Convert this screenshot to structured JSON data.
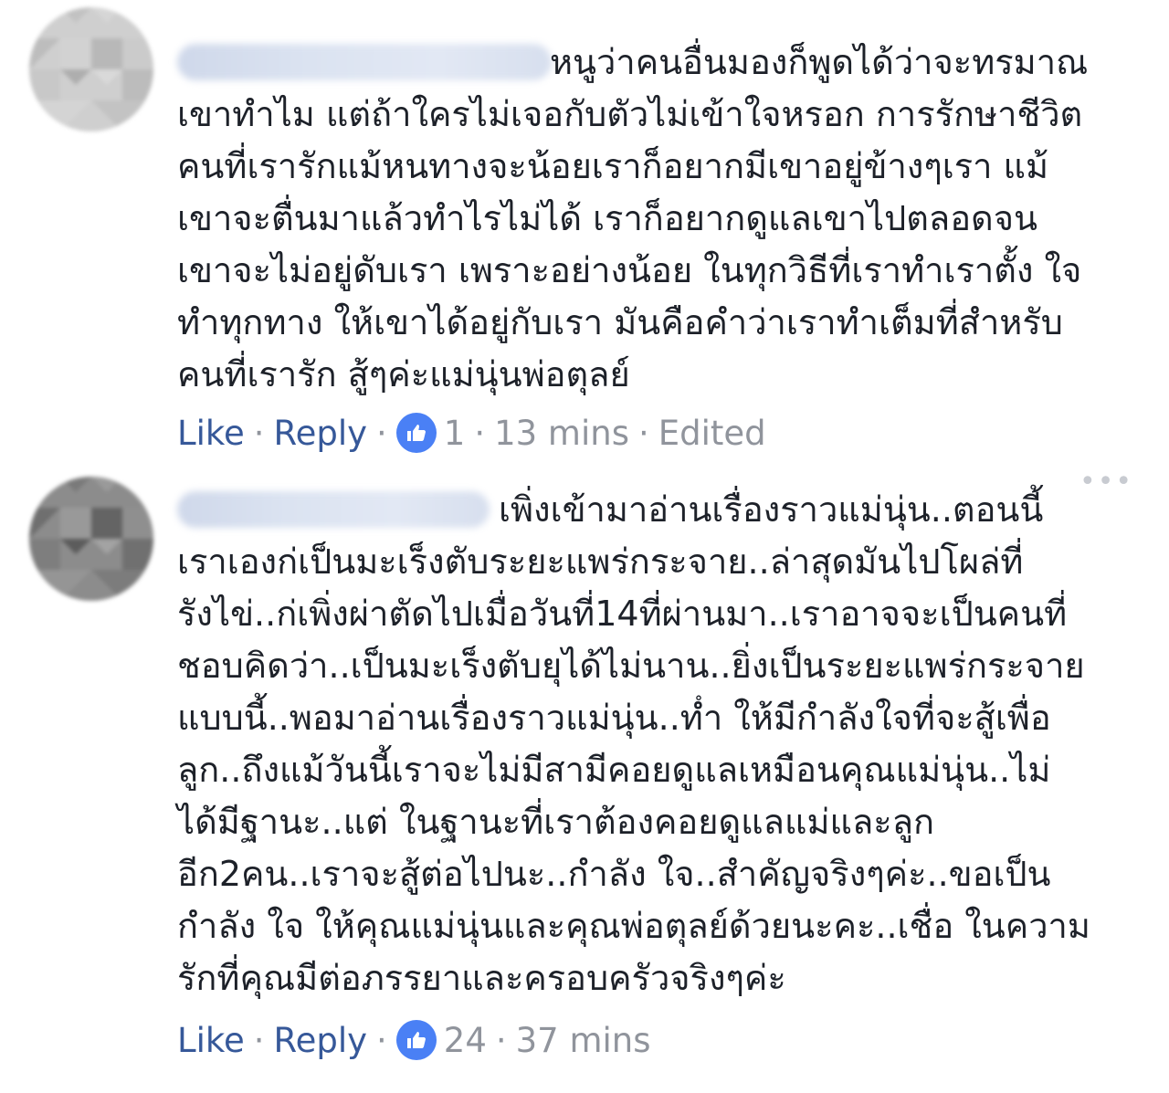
{
  "colors": {
    "link": "#365899",
    "meta": "#90949c",
    "text": "#1d2129",
    "like_badge": "#4a80f5"
  },
  "icons": {
    "reaction": "like-thumb-icon",
    "menu": "more-options-icon"
  },
  "comments": [
    {
      "text": "หนูว่าคนอื่นมองก็พูดได้ว่าจะทรมาณเขาทำไม แต่ถ้าใครไม่เจอกับตัวไม่เข้าใจหรอก การรักษาชีวิตคนที่เรารักแม้หนทางจะน้อยเราก็อยากมีเขาอยู่ข้างๆเรา แม้เขาจะตื่นมาแล้วทำไรไม่ได้ เราก็อยากดูแลเขาไปตลอดจนเขาจะไม่อยู่ดับเรา เพราะอย่างน้อย ในทุกวิธีที่เราทำเราตั้ง ใจทำทุกทาง ให้เขาได้อยู่กับเรา มันคือคำว่าเราทำเต็มที่สำหรับคนที่เรารัก สู้ๆค่ะแม่นุ่นพ่อตุลย์",
      "like_label": "Like",
      "reply_label": "Reply",
      "reaction_count": "1",
      "time": "13 mins",
      "edited": "Edited"
    },
    {
      "text": "เพิ่งเข้ามาอ่านเรื่องราวแม่นุ่น..ตอนนี้เราเองก่เป็นมะเร็งตับระยะแพร่กระจาย..ล่าสุดมันไปโผล่ที่รังไข่..ก่เพิ่งผ่าตัดไปเมื่อวันที่14ที่ผ่านมา..เราอาจจะเป็นคนที่ชอบคิดว่า..เป็นมะเร็งตับยุได้ไม่นาน..ยิ่งเป็นระยะแพร่กระจายแบบนี้..พอมาอ่านเรื่องราวแม่นุ่น..ทํำ ให้มีกำลังใจที่จะสู้เพื่อลูก..ถึงแม้วันนี้เราจะไม่มีสามีคอยดูแลเหมือนคุณแม่นุ่น..ไม่ได้มีฐานะ..แต่ ในฐานะที่เราต้องคอยดูแลแม่และลูกอีก2คน..เราจะสู้ต่อไปนะ..กำลัง ใจ..สำคัญจริงๆค่ะ..ขอเป็นกำลัง ใจ ให้คุณแม่นุ่นและคุณพ่อตุลย์ด้วยนะคะ..เชื่อ ในความรักที่คุณมีต่อภรรยาและครอบครัวจริงๆค่ะ",
      "like_label": "Like",
      "reply_label": "Reply",
      "reaction_count": "24",
      "time": "37 mins",
      "more_label": "•••"
    }
  ]
}
